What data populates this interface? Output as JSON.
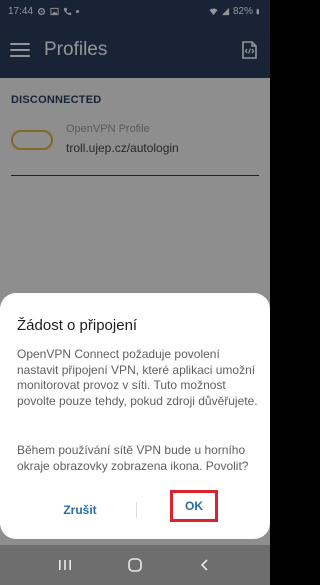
{
  "status_bar": {
    "time": "17:44",
    "battery": "82%"
  },
  "app_bar": {
    "title": "Profiles"
  },
  "profiles": {
    "section_header": "DISCONNECTED",
    "items": [
      {
        "name": "OpenVPN Profile",
        "host": "troll.ujep.cz/autologin"
      }
    ]
  },
  "dialog": {
    "title": "Žádost o připojení",
    "message_1": "OpenVPN Connect požaduje povolení nastavit připojení VPN, které aplikaci umožní monitorovat provoz v síti. Tuto možnost povolte pouze tehdy, pokud zdroji důvěřujete.",
    "message_2": "Během používání sítě VPN bude u horního okraje obrazovky zobrazena ikona. Povolit?",
    "cancel_label": "Zrušit",
    "ok_label": "OK"
  },
  "colors": {
    "app_bar": "#2a3e5d",
    "toggle_border": "#e0b341",
    "button_text": "#2b6ca3",
    "highlight": "#d9232e"
  },
  "icons": [
    "settings-gear-icon",
    "image-icon",
    "notification-dot-icon",
    "wifi-icon",
    "signal-icon",
    "battery-icon",
    "menu-icon",
    "import-profile-icon",
    "recent-apps-icon",
    "home-icon",
    "back-icon"
  ]
}
